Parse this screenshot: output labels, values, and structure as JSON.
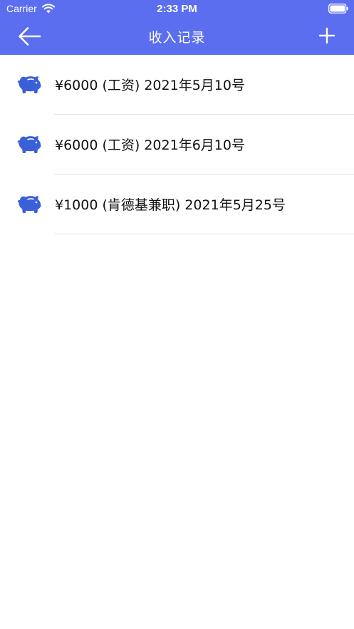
{
  "status_bar": {
    "carrier": "Carrier",
    "time": "2:33 PM",
    "wifi_icon": "wifi-icon",
    "battery_icon": "battery-icon"
  },
  "nav": {
    "title": "收入记录",
    "back_icon": "arrow-left-icon",
    "add_icon": "plus-icon",
    "background_color": "#5b6ef0"
  },
  "records": [
    {
      "text": "¥6000 (工资) 2021年5月10号",
      "icon": "piggy-bank-icon"
    },
    {
      "text": "¥6000 (工资) 2021年6月10号",
      "icon": "piggy-bank-icon"
    },
    {
      "text": "¥1000 (肯德基兼职) 2021年5月25号",
      "icon": "piggy-bank-icon"
    }
  ],
  "colors": {
    "accent": "#5b6ef0",
    "icon": "#3a5fd9",
    "separator": "#e3e3e6"
  }
}
